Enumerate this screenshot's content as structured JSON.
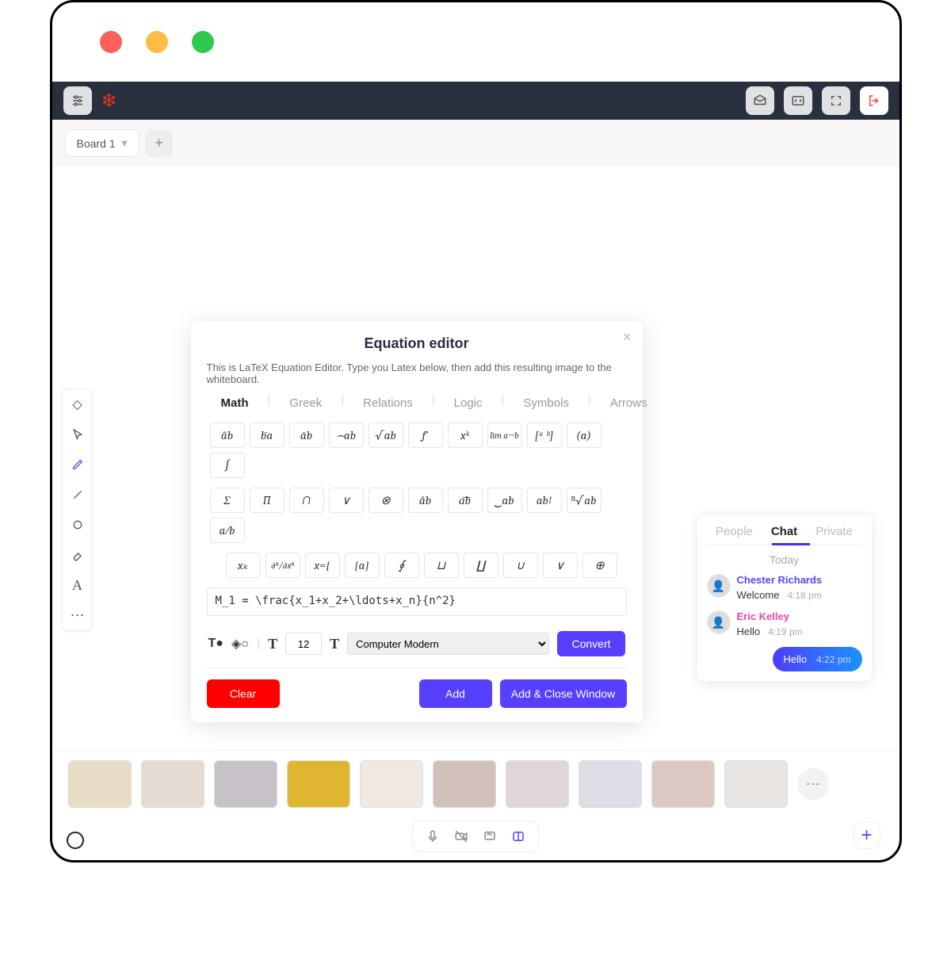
{
  "board": {
    "tab_label": "Board 1"
  },
  "modal": {
    "title": "Equation editor",
    "desc": "This is LaTeX Equation Editor. Type you Latex below, then add this resulting image to the whiteboard.",
    "tabs": [
      "Math",
      "Greek",
      "Relations",
      "Logic",
      "Symbols",
      "Arrows"
    ],
    "symbols_r1": [
      "ãb",
      "b̄a",
      "āb",
      "⌢ab",
      "√ab",
      "f′",
      "xᵏ",
      "lim a→b",
      "[ᵃ ᵇ]",
      "(a)",
      "∫"
    ],
    "symbols_r2": [
      "Σ",
      "∏",
      "∩",
      "∨",
      "⊗",
      "âb",
      "a͞b",
      "⏟ab",
      "ab↑",
      "ⁿ√ab",
      "a⁄b"
    ],
    "symbols_r3": [
      "xₖ",
      "∂ⁿ/∂xⁿ",
      "x={",
      "{a}",
      "∮",
      "⊔",
      "∐",
      "∪",
      "∨",
      "⊕"
    ],
    "input_value": "M_1 = \\frac{x_1+x_2+\\ldots+x_n}{n^2}",
    "font_size": "12",
    "font_name": "Computer Modern",
    "convert_label": "Convert",
    "clear_label": "Clear",
    "add_label": "Add",
    "addclose_label": "Add & Close Window"
  },
  "chat": {
    "tabs": {
      "people": "People",
      "chat": "Chat",
      "private": "Private"
    },
    "today": "Today",
    "msg1": {
      "name": "Chester Richards",
      "text": "Welcome",
      "time": "4:18 pm"
    },
    "msg2": {
      "name": "Eric Kelley",
      "text": "Hello",
      "time": "4:19 pm"
    },
    "my": {
      "text": "Hello",
      "time": "4:22 pm"
    }
  }
}
